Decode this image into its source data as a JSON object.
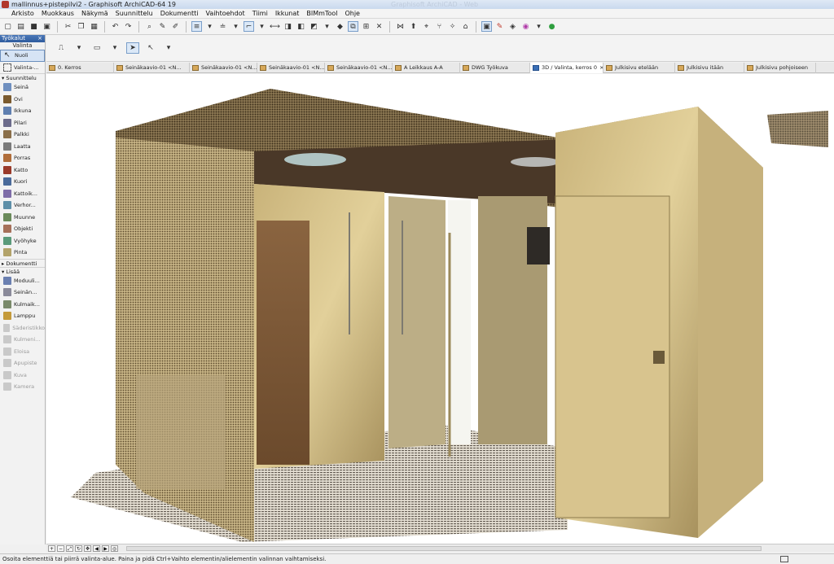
{
  "window": {
    "title": "mallinnus+pistepilvi2 - Graphisoft ArchiCAD-64 19",
    "ghost_text": "Graphisoft ArchiCAD - Web"
  },
  "menu": [
    "Arkisto",
    "Muokkaus",
    "Näkymä",
    "Suunnittelu",
    "Dokumentti",
    "Vaihtoehdot",
    "Tiimi",
    "Ikkunat",
    "BIMmTool",
    "Ohje"
  ],
  "toolbox": {
    "title": "Työkalut",
    "close": "×",
    "section_selection": "Valinta",
    "selected_tool": "Nuoli",
    "marquee_tool": "Valinta-...",
    "group_design": "Suunnittelu",
    "design_tools": [
      "Seinä",
      "Ovi",
      "Ikkuna",
      "Pilari",
      "Palkki",
      "Laatta",
      "Porras",
      "Katto",
      "Kuori",
      "Kattoik...",
      "Verhor...",
      "Muunne",
      "Objekti",
      "Vyöhyke",
      "Pinta"
    ],
    "group_document": "Dokumentti",
    "group_more": "Lisää",
    "more_tools": [
      "Moduuli...",
      "Seinän...",
      "Kulmaik...",
      "Lamppu"
    ],
    "disabled_tools": [
      "Säderistikko",
      "Kulmeni...",
      "Eloisa",
      "Apupiste",
      "Kuva",
      "Kamera"
    ]
  },
  "colors": {
    "tool_icons": [
      "#6f8fbf",
      "#7a5a2e",
      "#5f7fb0",
      "#6b6b8b",
      "#8a6f4a",
      "#7b7b7b",
      "#b06d3a",
      "#9a3a2a",
      "#4a6a9a",
      "#7e6da8",
      "#5e8fa8",
      "#6a8a5a",
      "#a6705a",
      "#5a9a7a",
      "#b3a36a"
    ],
    "more_icons": [
      "#6a7fb0",
      "#8a8a9a",
      "#7a8a6a",
      "#c49a3a"
    ]
  },
  "tabs": [
    {
      "label": "0. Kerros",
      "active": false
    },
    {
      "label": "Seinäkaavio-01 <N...",
      "active": false
    },
    {
      "label": "Seinäkaavio-01 <N...",
      "active": false
    },
    {
      "label": "Seinäkaavio-01 <N...",
      "active": false
    },
    {
      "label": "Seinäkaavio-01 <N...",
      "active": false
    },
    {
      "label": "A Leikkaus A-A",
      "active": false
    },
    {
      "label": "DWG Työkuva",
      "active": false
    },
    {
      "label": "3D / Valinta, kerros 0",
      "close": "×",
      "active": true
    },
    {
      "label": "Julkisivu etelään",
      "active": false
    },
    {
      "label": "Julkisivu itään",
      "active": false
    },
    {
      "label": "Julkisivu pohjoiseen",
      "active": false
    }
  ],
  "status": {
    "message": "Osoita elementtiä tai piirrä valinta-alue. Paina ja pidä Ctrl+Vaihto elementin/alielementin valinnan vaihtamiseksi."
  }
}
